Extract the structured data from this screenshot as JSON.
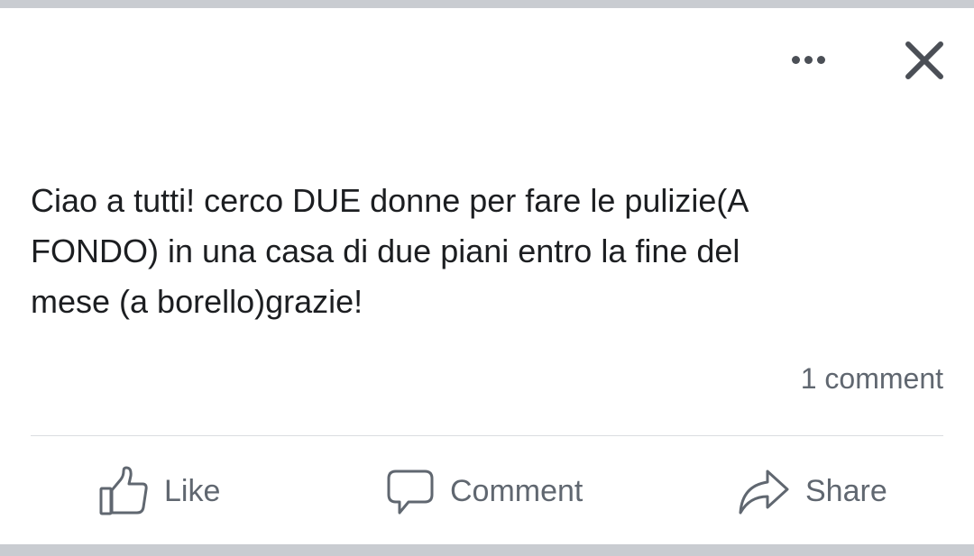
{
  "post": {
    "text": "Ciao a tutti! cerco DUE donne per fare le pulizie(A\nFONDO) in una casa di due piani entro la fine del\nmese (a borello)grazie!",
    "comment_count": "1 comment"
  },
  "header": {
    "more_icon": "more-options-icon",
    "close_icon": "close-icon"
  },
  "actions": {
    "like_label": "Like",
    "comment_label": "Comment",
    "share_label": "Share"
  },
  "colors": {
    "text": "#1c1e21",
    "secondary_text": "#606770",
    "icon": "#4b4f56",
    "divider": "#dadde1",
    "band": "#c9ccd1"
  }
}
